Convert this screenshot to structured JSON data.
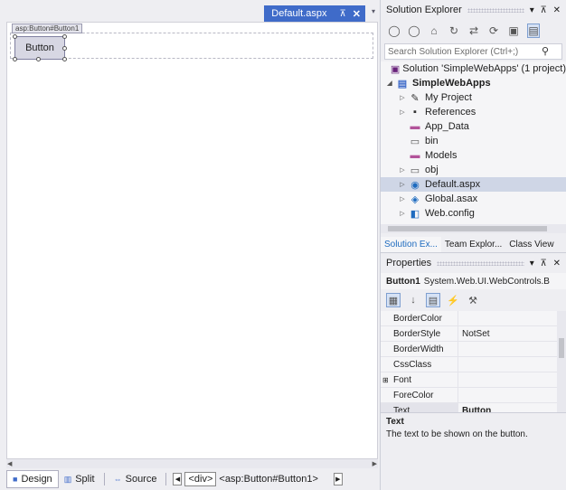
{
  "document_tab": {
    "title": "Default.aspx",
    "pin": "⊼",
    "close": "✕",
    "dropdown": "▾"
  },
  "designer": {
    "tag_label": "asp:Button#Button1",
    "button_text": "Button"
  },
  "bottom_bar": {
    "views": [
      "Design",
      "Split",
      "Source"
    ],
    "breadcrumbs": [
      "<div>",
      "<asp:Button#Button1>"
    ]
  },
  "solution_explorer": {
    "title": "Solution Explorer",
    "search_placeholder": "Search Solution Explorer (Ctrl+;)",
    "tree": [
      {
        "label": "Solution 'SimpleWebApps' (1 project)",
        "level": 0,
        "expander": "",
        "icon": "solution-icon"
      },
      {
        "label": "SimpleWebApps",
        "level": 0,
        "expander": "◢",
        "icon": "project-icon",
        "bold": true
      },
      {
        "label": "My Project",
        "level": 1,
        "expander": "▷",
        "icon": "wrench-icon"
      },
      {
        "label": "References",
        "level": 1,
        "expander": "▷",
        "icon": "references-icon"
      },
      {
        "label": "App_Data",
        "level": 1,
        "expander": "",
        "icon": "folder-icon"
      },
      {
        "label": "bin",
        "level": 1,
        "expander": "",
        "icon": "folder-outline-icon"
      },
      {
        "label": "Models",
        "level": 1,
        "expander": "",
        "icon": "folder-icon"
      },
      {
        "label": "obj",
        "level": 1,
        "expander": "▷",
        "icon": "folder-outline-icon"
      },
      {
        "label": "Default.aspx",
        "level": 1,
        "expander": "▷",
        "icon": "aspx-file-icon",
        "selected": true
      },
      {
        "label": "Global.asax",
        "level": 1,
        "expander": "▷",
        "icon": "asax-file-icon"
      },
      {
        "label": "Web.config",
        "level": 1,
        "expander": "▷",
        "icon": "config-file-icon"
      }
    ],
    "tabs": [
      "Solution Ex...",
      "Team Explor...",
      "Class View"
    ]
  },
  "properties": {
    "title": "Properties",
    "object_name": "Button1",
    "object_type": "System.Web.UI.WebControls.B",
    "rows": [
      {
        "name": "BorderColor",
        "value": ""
      },
      {
        "name": "BorderStyle",
        "value": "NotSet"
      },
      {
        "name": "BorderWidth",
        "value": ""
      },
      {
        "name": "CssClass",
        "value": ""
      },
      {
        "name": "Font",
        "value": "",
        "category": true
      },
      {
        "name": "ForeColor",
        "value": ""
      },
      {
        "name": "Text",
        "value": "Button",
        "bold": true,
        "selected": true
      }
    ],
    "description_title": "Text",
    "description_text": "The text to be shown on the button."
  },
  "colors": {
    "accent": "#3f6bc9",
    "selection": "#cfd6e6",
    "background": "#eeeef2"
  }
}
